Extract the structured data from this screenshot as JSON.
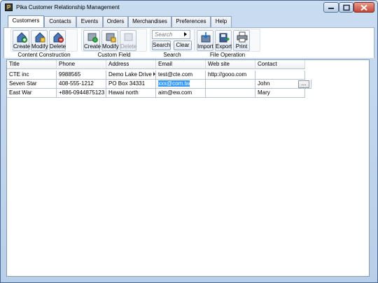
{
  "window": {
    "title": "Pika Customer Relationship Management",
    "app_icon_glyph": "P"
  },
  "tabs": [
    {
      "label": "Customers"
    },
    {
      "label": "Contacts"
    },
    {
      "label": "Events"
    },
    {
      "label": "Orders"
    },
    {
      "label": "Merchandises"
    },
    {
      "label": "Preferences"
    },
    {
      "label": "Help"
    }
  ],
  "active_tab": "Customers",
  "ribbon": {
    "content_construction": {
      "label": "Content Construction",
      "buttons": [
        {
          "label": "Create",
          "icon": "house-add-icon"
        },
        {
          "label": "Modify",
          "icon": "house-edit-icon"
        },
        {
          "label": "Delete",
          "icon": "house-delete-icon"
        }
      ]
    },
    "custom_field": {
      "label": "Custom Field",
      "buttons": [
        {
          "label": "Create",
          "icon": "field-add-icon"
        },
        {
          "label": "Modify",
          "icon": "field-edit-icon"
        },
        {
          "label": "Delete",
          "icon": "field-delete-icon",
          "disabled": true
        }
      ]
    },
    "search": {
      "label": "Search",
      "placeholder": "Search",
      "search_button": "Search",
      "clear_button": "Clear"
    },
    "file_operation": {
      "label": "File Operation",
      "buttons": [
        {
          "label": "Import",
          "icon": "import-icon"
        },
        {
          "label": "Export",
          "icon": "export-icon"
        },
        {
          "label": "Print",
          "icon": "printer-icon"
        }
      ]
    }
  },
  "table": {
    "columns": [
      "Title",
      "Phone",
      "Address",
      "Email",
      "Web site",
      "Contact"
    ],
    "rows": [
      [
        "CTE inc",
        "9988565",
        "Demo Lake Drive",
        "test@cte.com",
        "http://gooo.com",
        ""
      ],
      [
        "Seven Star",
        "408-555-1212",
        "PO Box 34331",
        "xxx@com.tw",
        "",
        "John"
      ],
      [
        "East War",
        "+886-0944875123",
        "Hawai north",
        "aim@ew.com",
        "",
        "Mary"
      ]
    ],
    "selected_cell": {
      "row": 1,
      "column": "Email"
    },
    "ellipsis_label": "..."
  }
}
